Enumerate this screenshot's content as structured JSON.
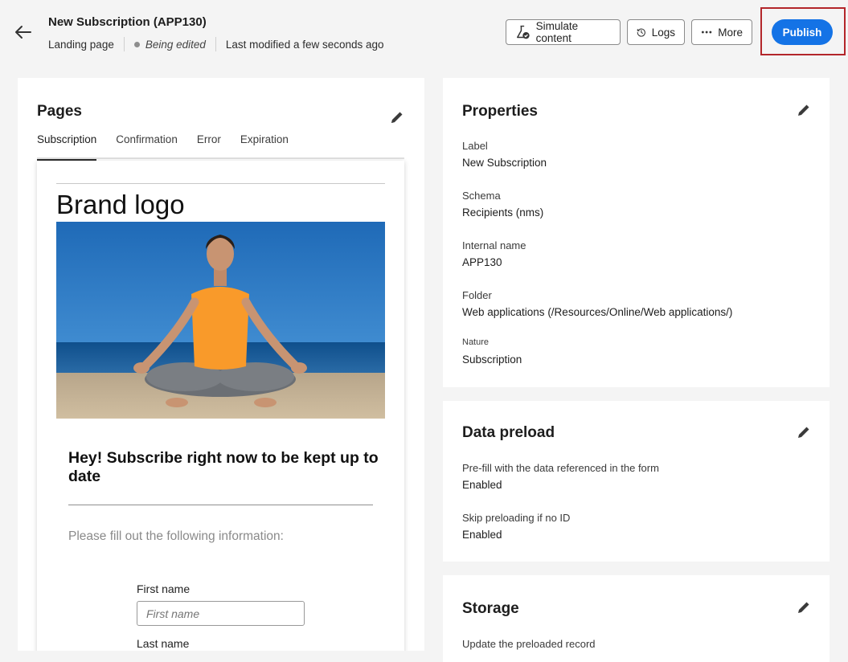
{
  "header": {
    "title": "New Subscription (APP130)",
    "type": "Landing page",
    "status": "Being edited",
    "modified": "Last modified a few seconds ago",
    "buttons": {
      "simulate": "Simulate content",
      "logs": "Logs",
      "more": "More",
      "publish": "Publish"
    },
    "accent_color": "#1473e6",
    "highlight_color": "#b3262a"
  },
  "pages": {
    "title": "Pages",
    "tabs": [
      "Subscription",
      "Confirmation",
      "Error",
      "Expiration"
    ],
    "active_tab": "Subscription",
    "preview": {
      "brand_logo": "Brand logo",
      "heading": "Hey! Subscribe right now to be kept up to date",
      "intro": "Please fill out the following information:",
      "first_name_label": "First name",
      "first_name_placeholder": "First name",
      "last_name_label": "Last name"
    }
  },
  "properties": {
    "title": "Properties",
    "fields": [
      {
        "label": "Label",
        "value": "New Subscription"
      },
      {
        "label": "Schema",
        "value": "Recipients (nms)"
      },
      {
        "label": "Internal name",
        "value": "APP130"
      },
      {
        "label": "Folder",
        "value": "Web applications (/Resources/Online/Web applications/)"
      },
      {
        "label": "Nature",
        "value": "Subscription"
      }
    ]
  },
  "data_preload": {
    "title": "Data preload",
    "fields": [
      {
        "label": "Pre-fill with the data referenced in the form",
        "value": "Enabled"
      },
      {
        "label": "Skip preloading if no ID",
        "value": "Enabled"
      }
    ]
  },
  "storage": {
    "title": "Storage",
    "fields": [
      {
        "label": "Update the preloaded record"
      }
    ]
  }
}
